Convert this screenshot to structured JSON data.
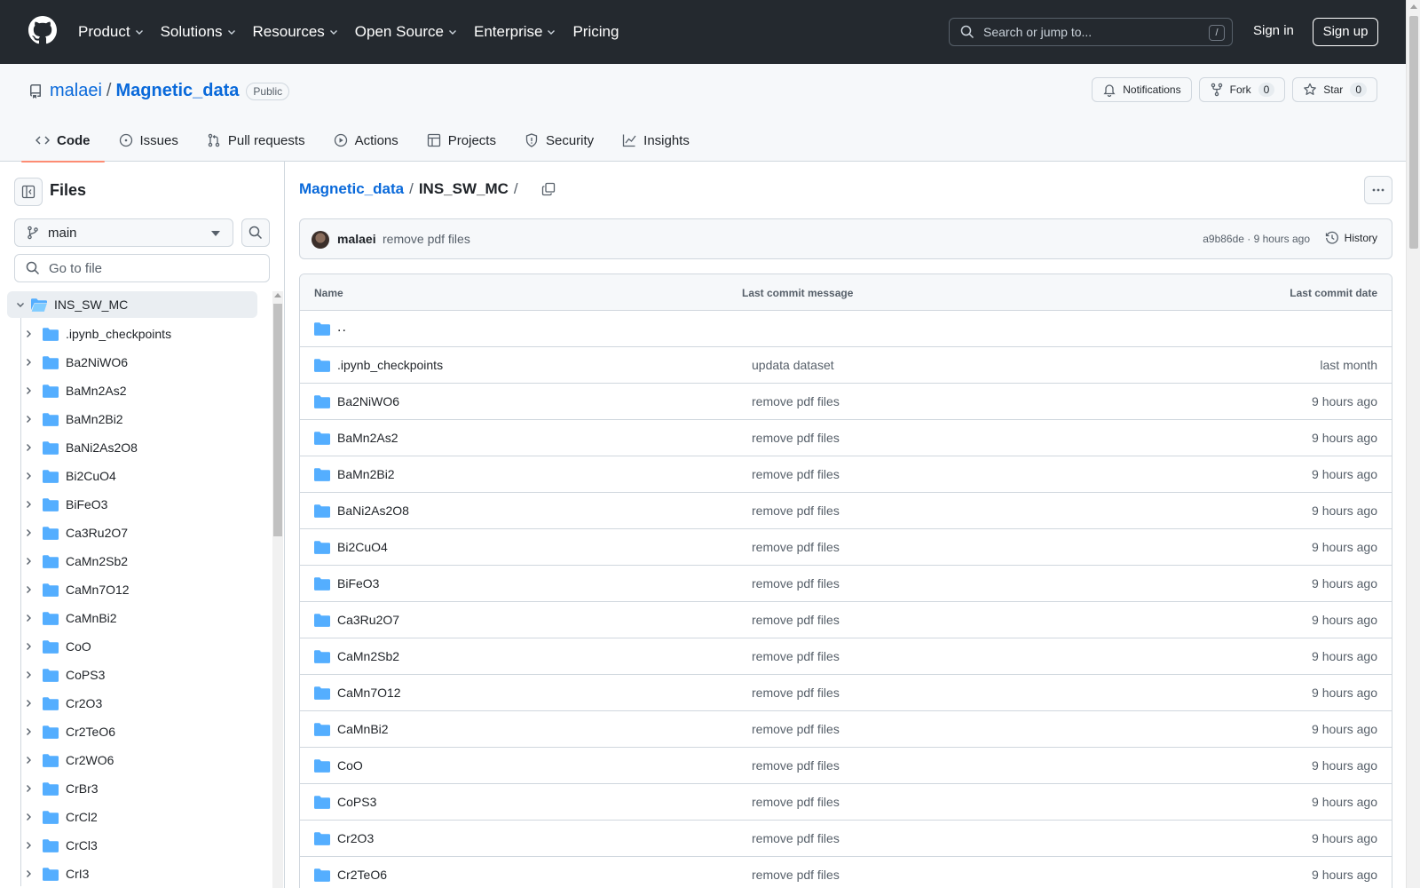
{
  "header": {
    "nav": [
      "Product",
      "Solutions",
      "Resources",
      "Open Source",
      "Enterprise",
      "Pricing"
    ],
    "search_placeholder": "Search or jump to...",
    "search_shortcut": "/",
    "sign_in": "Sign in",
    "sign_up": "Sign up"
  },
  "repo": {
    "owner": "malaei",
    "separator": "/",
    "name": "Magnetic_data",
    "visibility": "Public",
    "notifications_label": "Notifications",
    "fork_label": "Fork",
    "fork_count": "0",
    "star_label": "Star",
    "star_count": "0",
    "tabs": [
      "Code",
      "Issues",
      "Pull requests",
      "Actions",
      "Projects",
      "Security",
      "Insights"
    ]
  },
  "sidebar": {
    "title": "Files",
    "branch": "main",
    "goto_placeholder": "Go to file",
    "root_folder": "INS_SW_MC",
    "items": [
      ".ipynb_checkpoints",
      "Ba2NiWO6",
      "BaMn2As2",
      "BaMn2Bi2",
      "BaNi2As2O8",
      "Bi2CuO4",
      "BiFeO3",
      "Ca3Ru2O7",
      "CaMn2Sb2",
      "CaMn7O12",
      "CaMnBi2",
      "CoO",
      "CoPS3",
      "Cr2O3",
      "Cr2TeO6",
      "Cr2WO6",
      "CrBr3",
      "CrCl2",
      "CrCl3",
      "CrI3"
    ]
  },
  "main": {
    "breadcrumb_repo": "Magnetic_data",
    "breadcrumb_sep": "/",
    "breadcrumb_current": "INS_SW_MC",
    "breadcrumb_trailing": "/",
    "commit": {
      "author": "malaei",
      "message": "remove pdf files",
      "meta": "a9b86de · 9 hours ago",
      "history_label": "History"
    },
    "table": {
      "headers": [
        "Name",
        "Last commit message",
        "Last commit date"
      ],
      "parent_dir": "..",
      "rows": [
        {
          "name": ".ipynb_checkpoints",
          "message": "updata dataset",
          "date": "last month"
        },
        {
          "name": "Ba2NiWO6",
          "message": "remove pdf files",
          "date": "9 hours ago"
        },
        {
          "name": "BaMn2As2",
          "message": "remove pdf files",
          "date": "9 hours ago"
        },
        {
          "name": "BaMn2Bi2",
          "message": "remove pdf files",
          "date": "9 hours ago"
        },
        {
          "name": "BaNi2As2O8",
          "message": "remove pdf files",
          "date": "9 hours ago"
        },
        {
          "name": "Bi2CuO4",
          "message": "remove pdf files",
          "date": "9 hours ago"
        },
        {
          "name": "BiFeO3",
          "message": "remove pdf files",
          "date": "9 hours ago"
        },
        {
          "name": "Ca3Ru2O7",
          "message": "remove pdf files",
          "date": "9 hours ago"
        },
        {
          "name": "CaMn2Sb2",
          "message": "remove pdf files",
          "date": "9 hours ago"
        },
        {
          "name": "CaMn7O12",
          "message": "remove pdf files",
          "date": "9 hours ago"
        },
        {
          "name": "CaMnBi2",
          "message": "remove pdf files",
          "date": "9 hours ago"
        },
        {
          "name": "CoO",
          "message": "remove pdf files",
          "date": "9 hours ago"
        },
        {
          "name": "CoPS3",
          "message": "remove pdf files",
          "date": "9 hours ago"
        },
        {
          "name": "Cr2O3",
          "message": "remove pdf files",
          "date": "9 hours ago"
        },
        {
          "name": "Cr2TeO6",
          "message": "remove pdf files",
          "date": "9 hours ago"
        }
      ]
    }
  },
  "colors": {
    "header_bg": "#24292f",
    "link": "#0969da",
    "folder": "#54aeff",
    "active_tab_underline": "#fd8c73"
  }
}
